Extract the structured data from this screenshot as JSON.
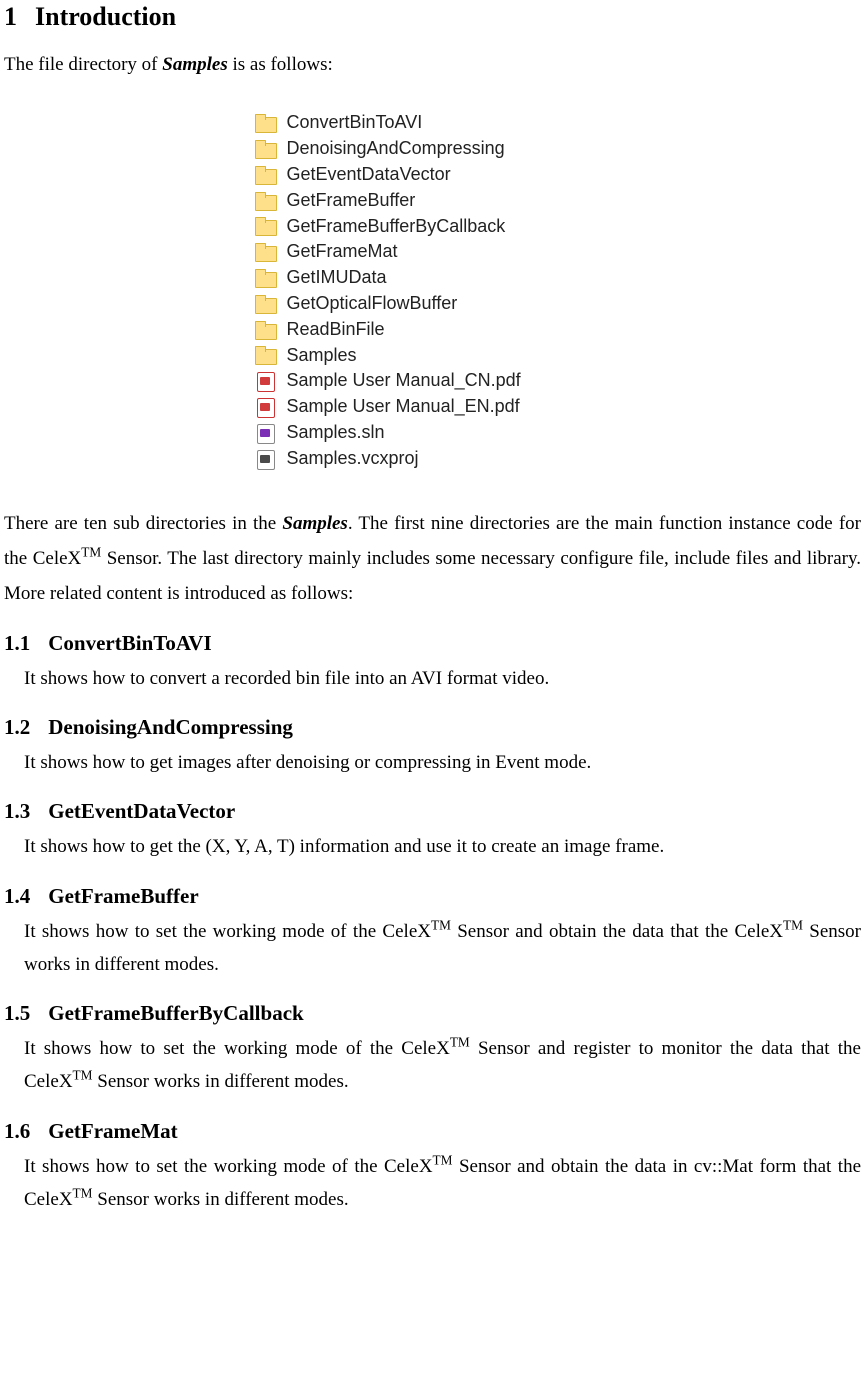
{
  "heading": {
    "number": "1",
    "title": "Introduction"
  },
  "intro": {
    "prefix": "The file directory of ",
    "bold_italic": "Samples",
    "suffix": " is as follows:"
  },
  "files": [
    {
      "icon": "folder",
      "name": "ConvertBinToAVI"
    },
    {
      "icon": "folder",
      "name": "DenoisingAndCompressing"
    },
    {
      "icon": "folder",
      "name": "GetEventDataVector"
    },
    {
      "icon": "folder",
      "name": "GetFrameBuffer"
    },
    {
      "icon": "folder",
      "name": "GetFrameBufferByCallback"
    },
    {
      "icon": "folder",
      "name": "GetFrameMat"
    },
    {
      "icon": "folder",
      "name": "GetIMUData"
    },
    {
      "icon": "folder",
      "name": "GetOpticalFlowBuffer"
    },
    {
      "icon": "folder",
      "name": "ReadBinFile"
    },
    {
      "icon": "folder",
      "name": "Samples"
    },
    {
      "icon": "pdf",
      "name": "Sample User Manual_CN.pdf"
    },
    {
      "icon": "pdf",
      "name": "Sample User Manual_EN.pdf"
    },
    {
      "icon": "sln",
      "name": "Samples.sln"
    },
    {
      "icon": "proj",
      "name": "Samples.vcxproj"
    }
  ],
  "middle": {
    "p1": "There are ten sub directories in the ",
    "bold_italic": "Samples",
    "p2": ". The first nine directories are the main function instance code for the CeleX",
    "tm": "TM",
    "p3": " Sensor. The last directory mainly includes some necessary configure file, include files and library. More related content is introduced as follows:"
  },
  "subsections": [
    {
      "num": "1.1",
      "title": "ConvertBinToAVI",
      "body_html": "It shows how to convert a recorded bin file into an AVI format video."
    },
    {
      "num": "1.2",
      "title": "DenoisingAndCompressing",
      "body_html": "It shows how to get images after denoising or compressing in Event mode."
    },
    {
      "num": "1.3",
      "title": "GetEventDataVector",
      "body_html": "It shows how to get the (X, Y, A, T) information and use it to create an image frame."
    },
    {
      "num": "1.4",
      "title": "GetFrameBuffer",
      "body_html": "It shows how to set the working mode of the CeleX<sup>TM</sup> Sensor and obtain the data that the CeleX<sup>TM</sup> Sensor works in different modes."
    },
    {
      "num": "1.5",
      "title": "GetFrameBufferByCallback",
      "body_html": "It shows how to set the working mode of the CeleX<sup>TM</sup> Sensor and register to monitor the data that the CeleX<sup>TM</sup> Sensor works in different modes."
    },
    {
      "num": "1.6",
      "title": "GetFrameMat",
      "body_html": "It shows how to set the working mode of the CeleX<sup>TM</sup> Sensor and obtain the data in cv::Mat form that the CeleX<sup>TM</sup> Sensor works in different modes."
    }
  ]
}
